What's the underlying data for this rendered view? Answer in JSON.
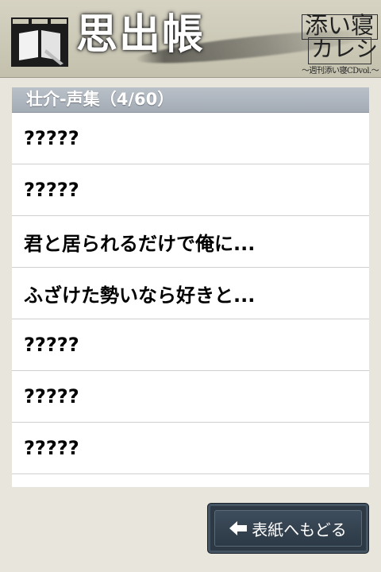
{
  "header": {
    "title": "思出帳",
    "logo": {
      "line1": "添い寝",
      "line2": "カレシ",
      "subtitle": "〜週刊添い寝CDvol.〜"
    }
  },
  "section": {
    "title": "壮介-声集（4/60）"
  },
  "items": [
    {
      "label": "?????"
    },
    {
      "label": "?????"
    },
    {
      "label": "君と居られるだけで俺に..."
    },
    {
      "label": "ふざけた勢いなら好きと..."
    },
    {
      "label": "?????"
    },
    {
      "label": "?????"
    },
    {
      "label": "?????"
    },
    {
      "label": ""
    }
  ],
  "footer": {
    "back_label": "表紙へもどる",
    "back_icon": "arrow-left-icon"
  }
}
